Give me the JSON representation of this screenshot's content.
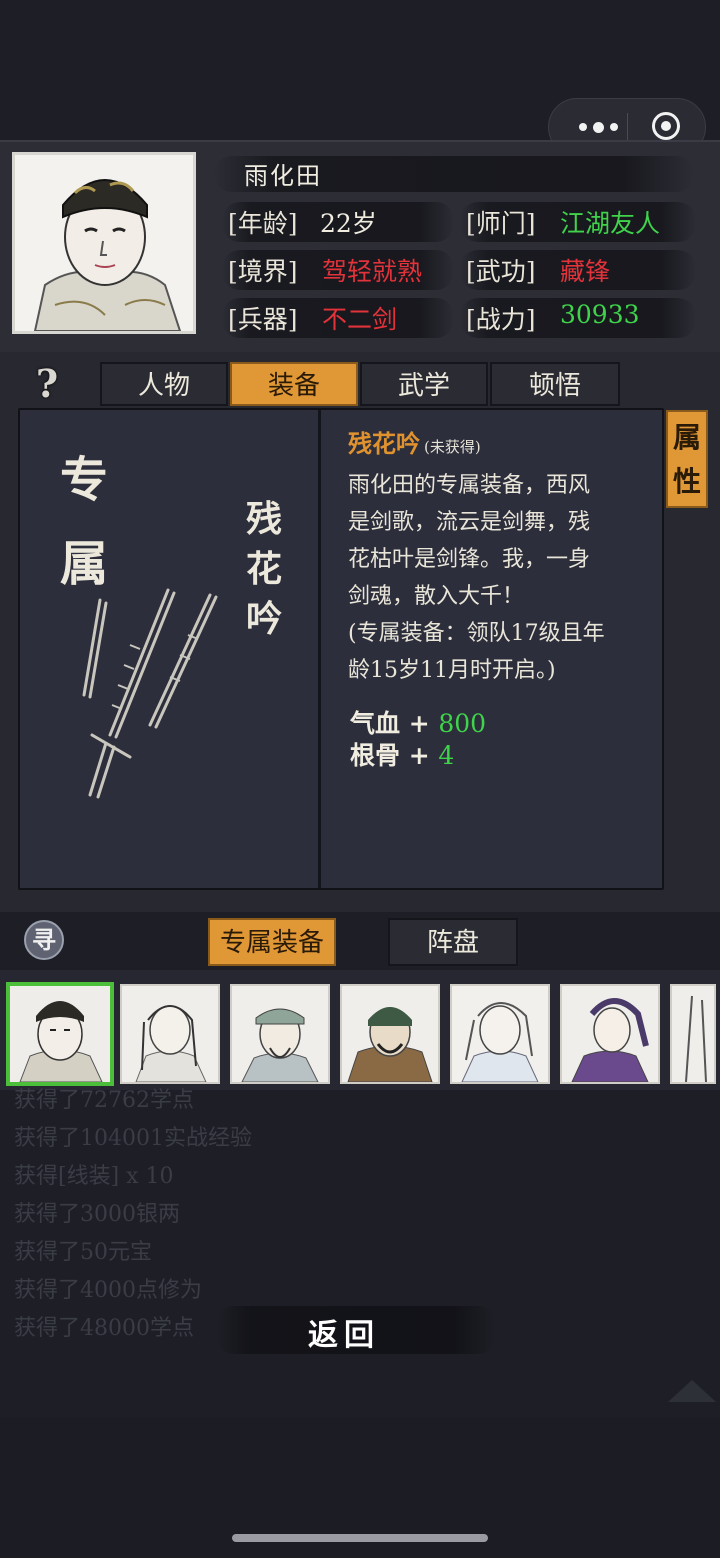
{
  "hero": {
    "name": "雨化田",
    "stats": [
      {
        "label": "[年龄]",
        "value": "22岁",
        "color": "#f0ece0"
      },
      {
        "label": "[师门]",
        "value": "江湖友人",
        "color": "#3fd24a"
      },
      {
        "label": "[境界]",
        "value": "驾轻就熟",
        "color": "#e2323a"
      },
      {
        "label": "[武功]",
        "value": "藏锋",
        "color": "#e2323a"
      },
      {
        "label": "[兵器]",
        "value": "不二剑",
        "color": "#e2323a"
      },
      {
        "label": "[战力]",
        "value": "30933",
        "color": "#3fd24a"
      }
    ]
  },
  "tabs": {
    "help": "?",
    "items": [
      "人物",
      "装备",
      "武学",
      "顿悟"
    ],
    "active": "装备"
  },
  "equipment": {
    "category_char_1": "专",
    "category_char_2": "属",
    "name_vertical": [
      "残",
      "花",
      "吟"
    ],
    "title": "残花吟",
    "status": "(未获得)",
    "desc_lines": [
      "雨化田的专属装备，西风",
      "是剑歌，流云是剑舞，残",
      "花枯叶是剑锋。我，一身",
      "剑魂，散入大千！",
      "(专属装备：领队17级且年",
      "龄15岁11月时开启。)"
    ],
    "bonuses": [
      {
        "label": "气血 + ",
        "value": "800"
      },
      {
        "label": "根骨 + ",
        "value": "4"
      }
    ],
    "side_tab": [
      "属",
      "性"
    ]
  },
  "bottom_tabs": {
    "seek_icon": "寻",
    "items": [
      "专属装备",
      "阵盘"
    ],
    "active": "专属装备"
  },
  "heroes_strip_count": 7,
  "logs": [
    "获得了72762学点",
    "获得了104001实战经验",
    "获得[线装] x 10",
    "获得了3000银两",
    "获得了50元宝",
    "获得了4000点修为",
    "获得了48000学点"
  ],
  "back_label": "返回",
  "colors": {
    "accent": "#e09735",
    "green": "#3fd24a",
    "red": "#e2323a",
    "panel": "#2c2e3b"
  }
}
